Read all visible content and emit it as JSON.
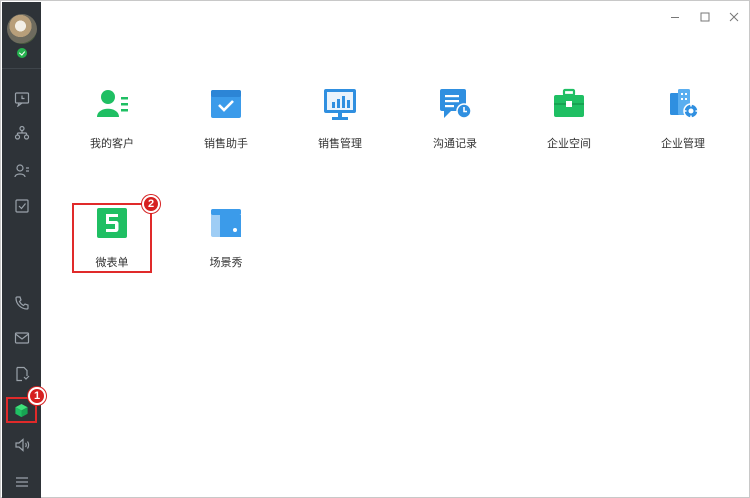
{
  "window": {
    "minimize_icon": "minimize-icon",
    "maximize_icon": "maximize-icon",
    "close_icon": "close-icon"
  },
  "sidebar": {
    "top_items": [
      {
        "icon": "chat-clock-icon"
      },
      {
        "icon": "org-chart-icon"
      },
      {
        "icon": "contacts-icon"
      },
      {
        "icon": "task-check-icon"
      }
    ],
    "bottom_items": [
      {
        "icon": "phone-icon"
      },
      {
        "icon": "mail-icon"
      },
      {
        "icon": "document-icon"
      },
      {
        "icon": "workbench-cube-icon",
        "active": true
      },
      {
        "icon": "announcement-icon"
      },
      {
        "icon": "menu-icon"
      }
    ]
  },
  "badges": {
    "one": "1",
    "two": "2"
  },
  "apps": {
    "row1": [
      {
        "label": "我的客户",
        "icon": "customer-icon",
        "color": "#1fbf63"
      },
      {
        "label": "销售助手",
        "icon": "sales-assistant-icon",
        "color": "#3b9bea"
      },
      {
        "label": "销售管理",
        "icon": "sales-management-icon",
        "color": "#2f8fe0"
      },
      {
        "label": "沟通记录",
        "icon": "communication-record-icon",
        "color": "#2f8fe0"
      },
      {
        "label": "企业空间",
        "icon": "enterprise-space-icon",
        "color": "#1fbf63"
      },
      {
        "label": "企业管理",
        "icon": "enterprise-management-icon",
        "color": "#2f8fe0"
      }
    ],
    "row2": [
      {
        "label": "微表单",
        "icon": "html5-form-icon",
        "color": "#1fbf63"
      },
      {
        "label": "场景秀",
        "icon": "scene-show-icon",
        "color": "#3b9bea"
      }
    ]
  },
  "colors": {
    "sidebar_bg": "#2e3338",
    "highlight": "#e02a2a",
    "green": "#1fbf63",
    "blue": "#2f8fe0"
  }
}
